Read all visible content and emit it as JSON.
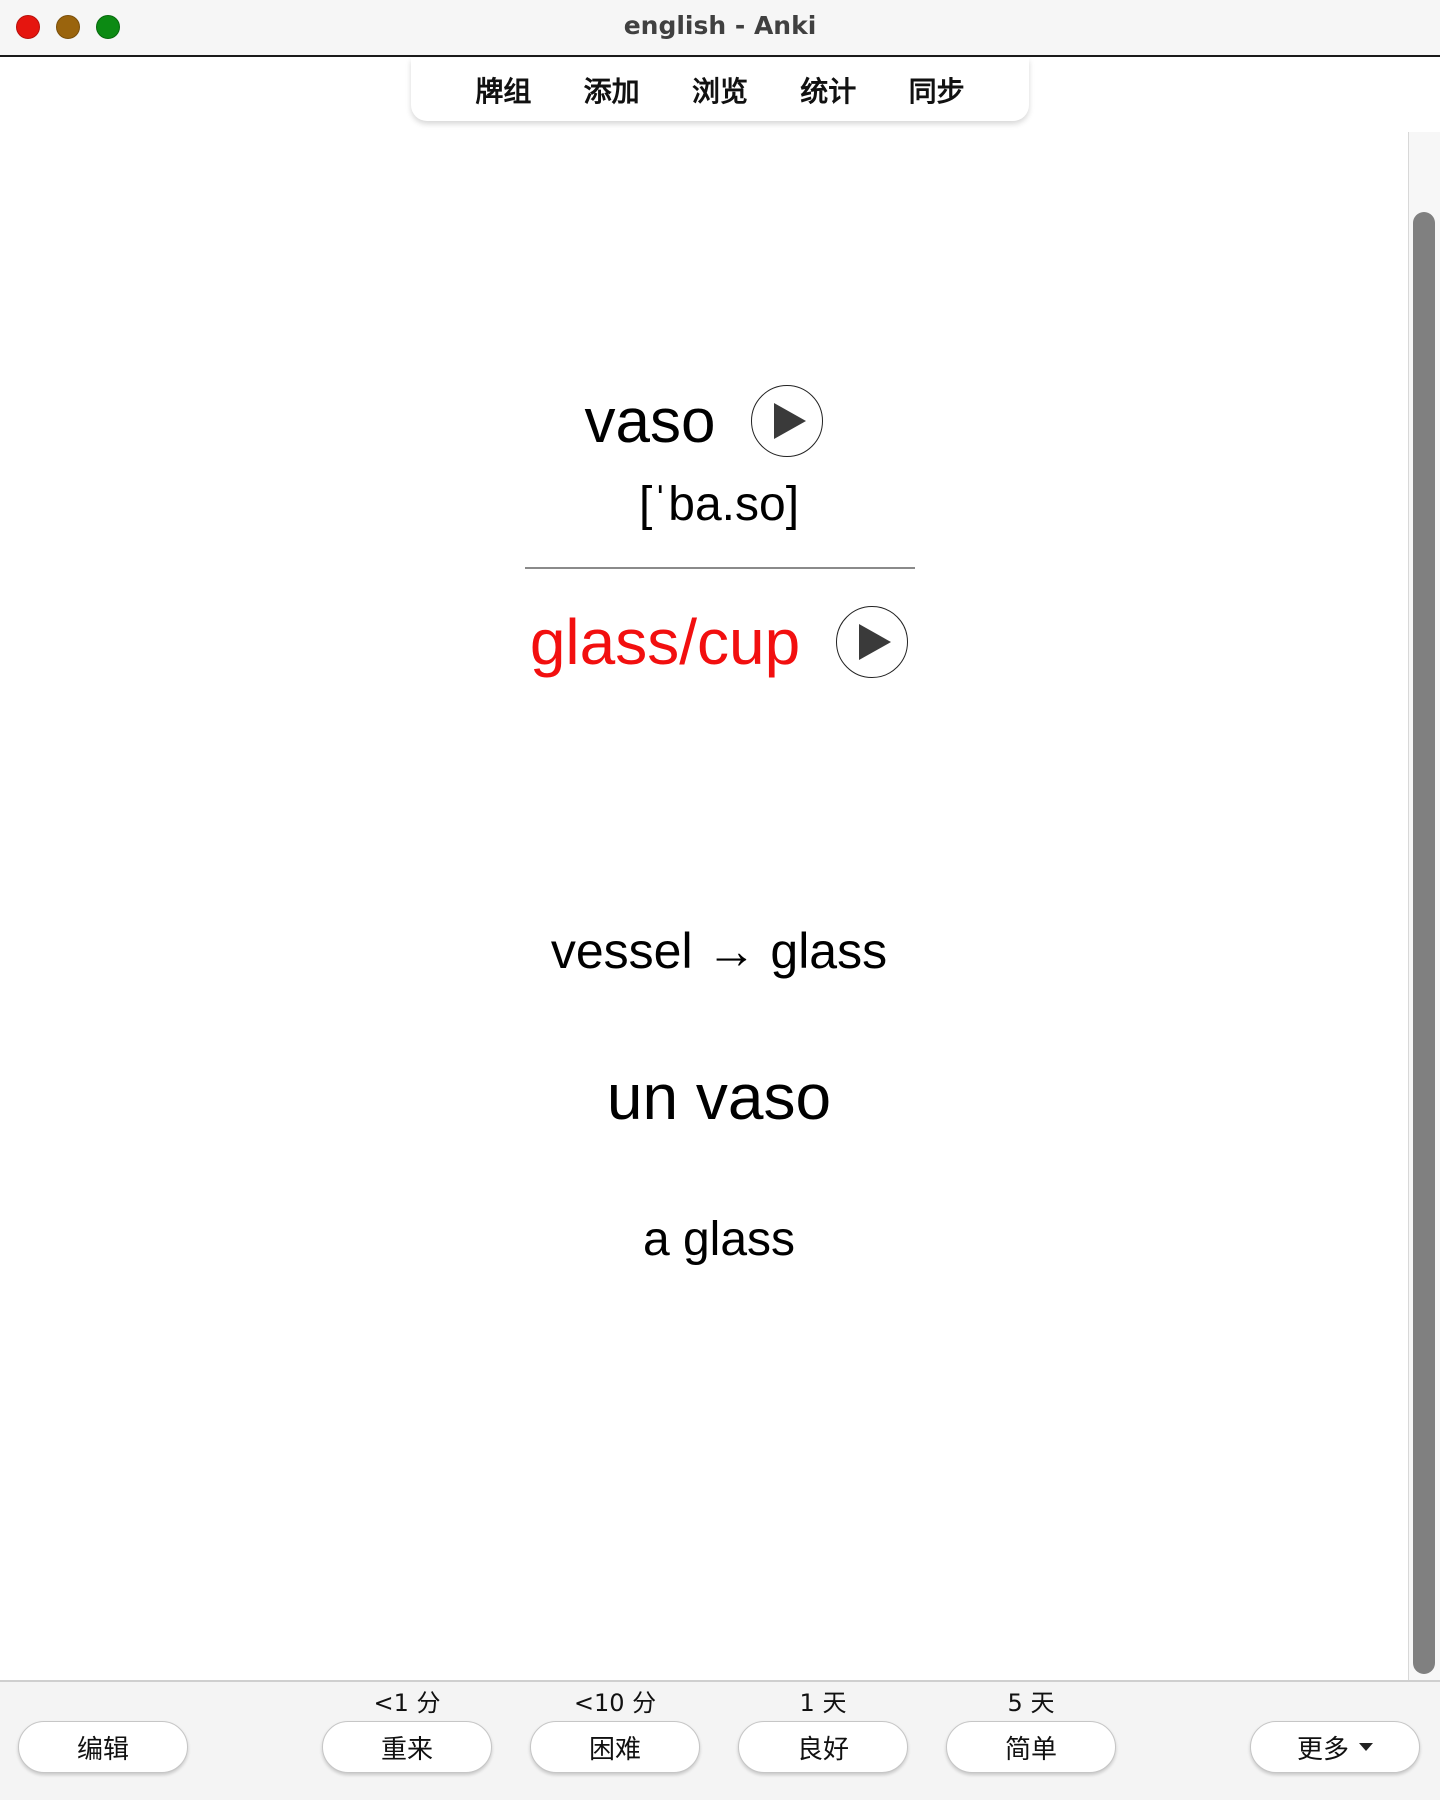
{
  "window": {
    "title": "english - Anki"
  },
  "toolbar": {
    "items": [
      {
        "label": "牌组"
      },
      {
        "label": "添加"
      },
      {
        "label": "浏览"
      },
      {
        "label": "统计"
      },
      {
        "label": "同步"
      }
    ]
  },
  "card": {
    "word": "vaso",
    "ipa": "[ˈba.so]",
    "meaning": "glass/cup",
    "meaning_color": "#f20f0f",
    "etymology": "vessel → glass",
    "example": "un vaso",
    "example_translation": "a glass"
  },
  "bottom": {
    "edit_label": "编辑",
    "more_label": "更多",
    "answers": [
      {
        "interval": "<1 分",
        "label": "重来"
      },
      {
        "interval": "<10 分",
        "label": "困难"
      },
      {
        "interval": "1 天",
        "label": "良好"
      },
      {
        "interval": "5 天",
        "label": "简单"
      }
    ]
  },
  "colors": {
    "close": "#e5150f",
    "minimize": "#9a640d",
    "maximize": "#0c8a13"
  }
}
